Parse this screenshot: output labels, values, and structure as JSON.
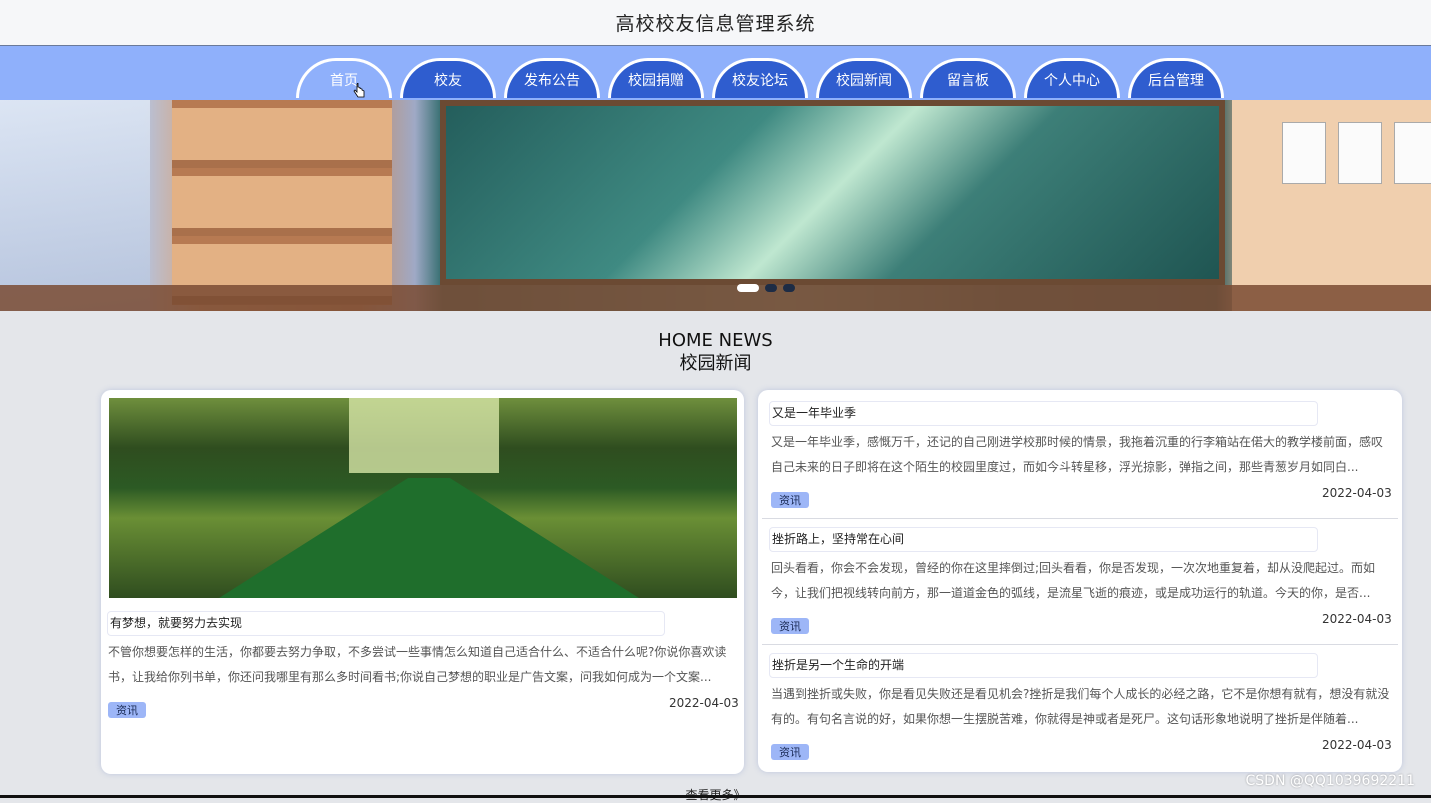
{
  "header": {
    "title": "高校校友信息管理系统"
  },
  "nav": {
    "items": [
      "首页",
      "校友",
      "发布公告",
      "校园捐赠",
      "校友论坛",
      "校园新闻",
      "留言板",
      "个人中心",
      "后台管理"
    ],
    "active_index": 0
  },
  "banner": {
    "slides": 3,
    "active_slide": 0
  },
  "section": {
    "en_title": "HOME NEWS",
    "cn_title": "校园新闻"
  },
  "featured": {
    "title": "有梦想，就要努力去实现",
    "summary": "不管你想要怎样的生活，你都要去努力争取，不多尝试一些事情怎么知道自己适合什么、不适合什么呢?你说你喜欢读书，让我给你列书单，你还问我哪里有那么多时间看书;你说自己梦想的职业是广告文案，问我如何成为一个文案...",
    "tag": "资讯",
    "date": "2022-04-03"
  },
  "news_list": [
    {
      "title": "又是一年毕业季",
      "summary": "又是一年毕业季，感慨万千，还记的自己刚进学校那时候的情景，我拖着沉重的行李箱站在偌大的教学楼前面，感叹自己未来的日子即将在这个陌生的校园里度过，而如今斗转星移，浮光掠影，弹指之间，那些青葱岁月如同白...",
      "tag": "资讯",
      "date": "2022-04-03"
    },
    {
      "title": "挫折路上，坚持常在心间",
      "summary": "回头看看，你会不会发现，曾经的你在这里摔倒过;回头看看，你是否发现，一次次地重复着，却从没爬起过。而如今，让我们把视线转向前方，那一道道金色的弧线，是流星飞逝的痕迹，或是成功运行的轨道。今天的你，是否...",
      "tag": "资讯",
      "date": "2022-04-03"
    },
    {
      "title": "挫折是另一个生命的开端",
      "summary": "当遇到挫折或失败，你是看见失败还是看见机会?挫折是我们每个人成长的必经之路，它不是你想有就有，想没有就没有的。有句名言说的好，如果你想一生摆脱苦难，你就得是神或者是死尸。这句话形象地说明了挫折是伴随着...",
      "tag": "资讯",
      "date": "2022-04-03"
    }
  ],
  "more_link": "查看更多》",
  "watermark": "CSDN @QQ1039692211",
  "colors": {
    "nav_bg": "#8fb0fb",
    "nav_tab": "#2f5dcf",
    "tag_bg": "#9db6f7"
  }
}
